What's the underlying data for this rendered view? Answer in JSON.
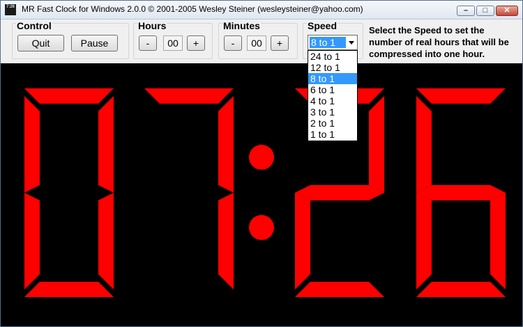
{
  "window": {
    "title": "MR Fast Clock for Windows 2.0.0 © 2001-2005 Wesley Steiner (wesleysteiner@yahoo.com)",
    "buttons": {
      "minimize": "–",
      "maximize": "□",
      "close": "✕"
    }
  },
  "control": {
    "label": "Control",
    "quit": "Quit",
    "pause": "Pause"
  },
  "hours": {
    "label": "Hours",
    "minus": "-",
    "value": "00",
    "plus": "+"
  },
  "minutes": {
    "label": "Minutes",
    "minus": "-",
    "value": "00",
    "plus": "+"
  },
  "speed": {
    "label": "Speed",
    "selected": "8 to 1",
    "options": [
      "24 to 1",
      "12 to 1",
      "8 to 1",
      "6 to 1",
      "4 to 1",
      "3 to 1",
      "2 to 1",
      "1 to 1"
    ],
    "help": "Select the Speed to set the number of real hours that will be compressed into one hour."
  },
  "clock": {
    "digits": [
      "0",
      "7",
      "2",
      "6"
    ],
    "color": "#ff0000",
    "background": "#000000"
  },
  "colors": {
    "accent": "#3399ff",
    "segment": "#ff0000"
  },
  "icons": {
    "app": "clock-app-icon"
  }
}
